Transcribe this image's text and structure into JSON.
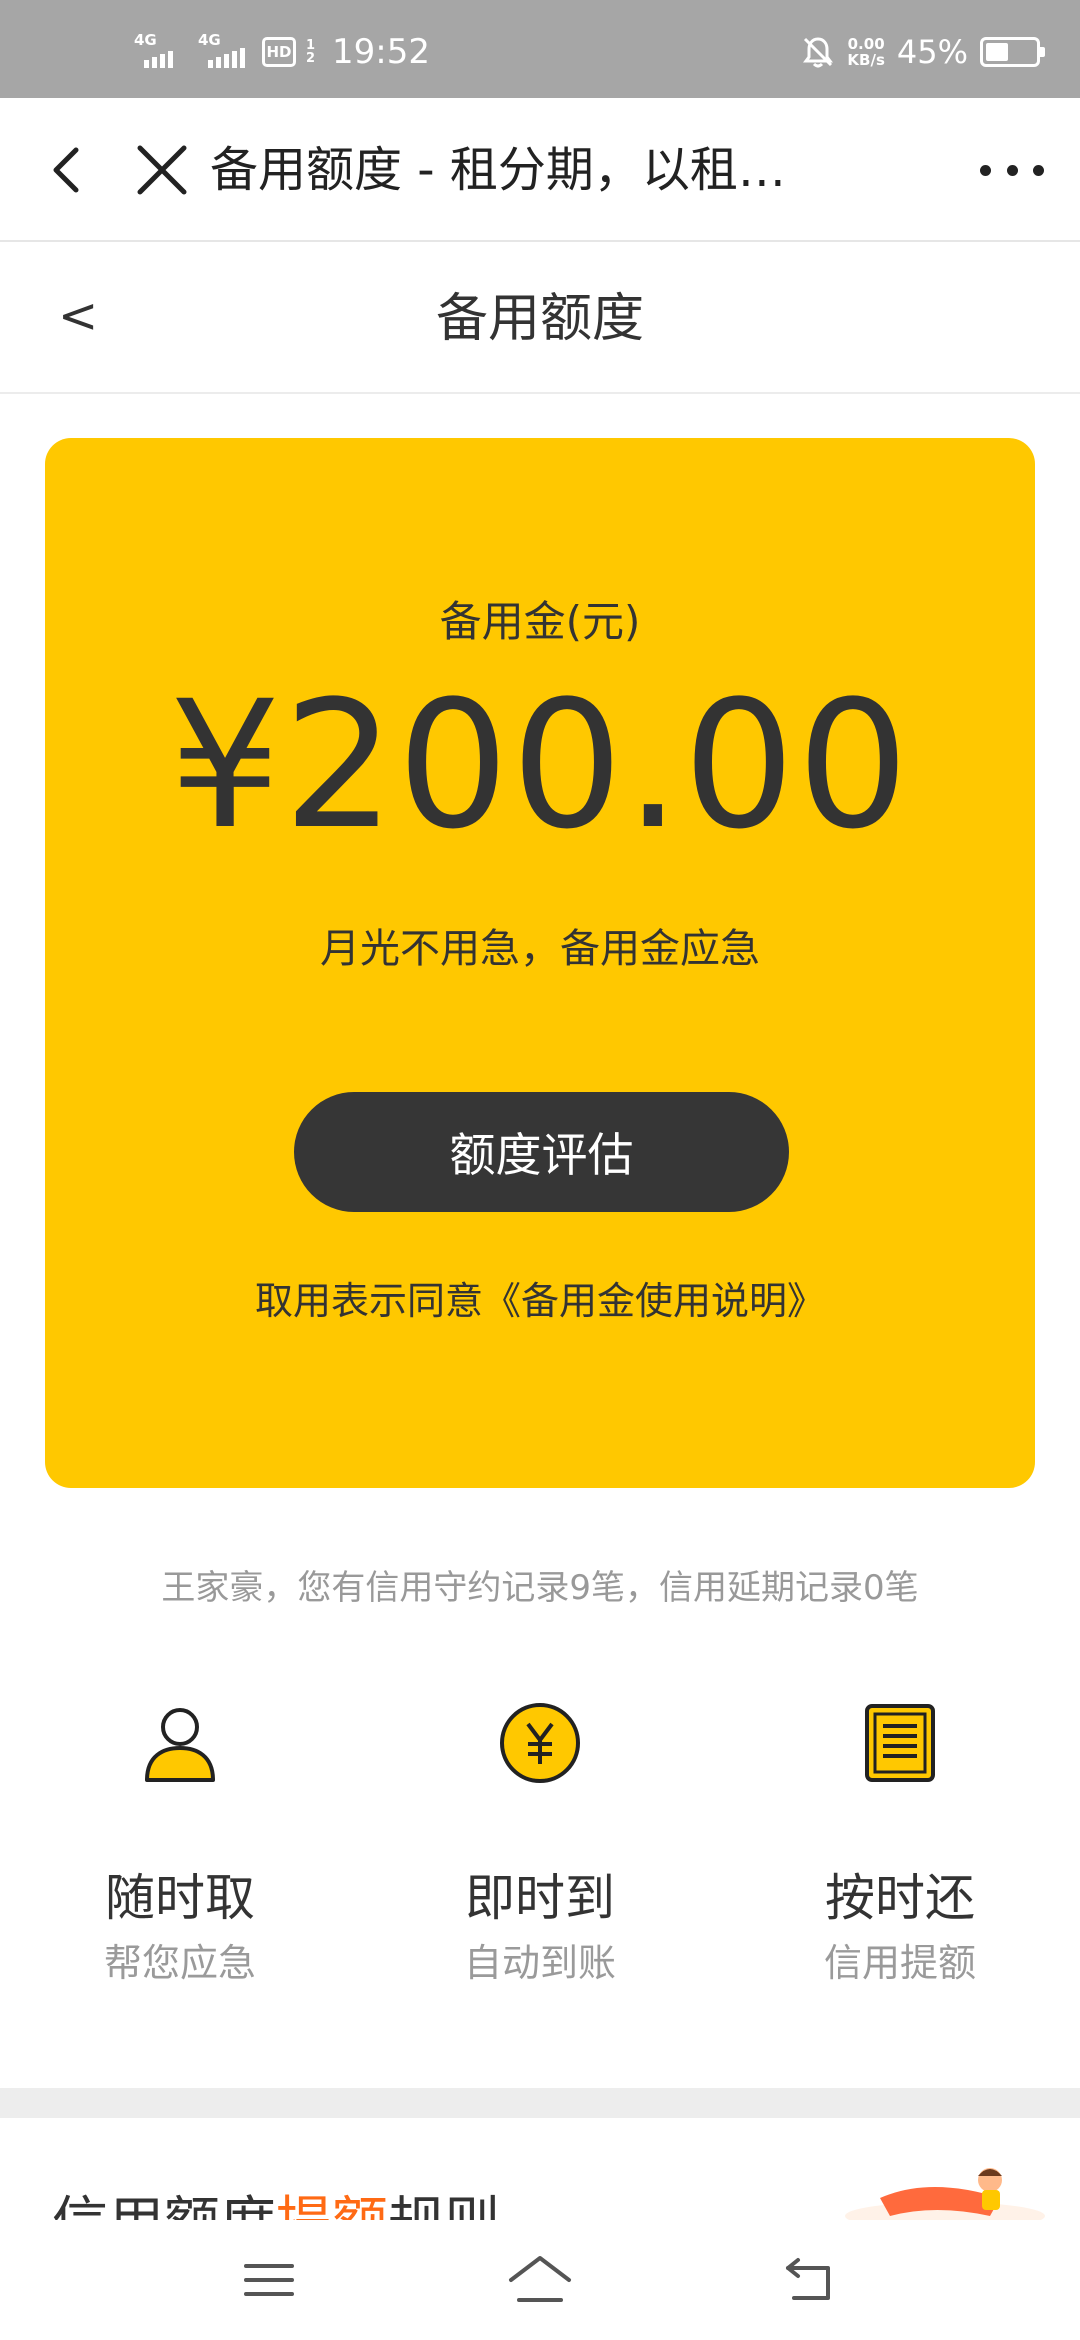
{
  "status_bar": {
    "signal1": "4G",
    "signal2": "4G",
    "hd_label": "HD",
    "hd_sub": "1 2",
    "time": "19:52",
    "net_speed_value": "0.00",
    "net_speed_unit": "KB/s",
    "battery_percent_text": "45%",
    "battery_level": 0.45
  },
  "browser_bar": {
    "title": "备用额度 - 租分期，以租…"
  },
  "page_header": {
    "back_label": "<",
    "title": "备用额度"
  },
  "card": {
    "label": "备用金(元)",
    "amount": "¥200.00",
    "slogan": "月光不用急，备用金应急",
    "button_label": "额度评估",
    "agreement": "取用表示同意《备用金使用说明》"
  },
  "record_text": "王家豪，您有信用守约记录9笔，信用延期记录0笔",
  "features": [
    {
      "icon": "user-icon",
      "title": "随时取",
      "subtitle": "帮您应急"
    },
    {
      "icon": "yen-coin-icon",
      "title": "即时到",
      "subtitle": "自动到账"
    },
    {
      "icon": "document-list-icon",
      "title": "按时还",
      "subtitle": "信用提额"
    }
  ],
  "bottom_section": {
    "title_part1": "信用额度",
    "title_highlight": "提额",
    "title_part2": "规则"
  },
  "colors": {
    "card_bg": "#ffc800",
    "button_bg": "#363636",
    "highlight": "#ff6a14",
    "status_bar_bg": "#a6a6a6"
  }
}
